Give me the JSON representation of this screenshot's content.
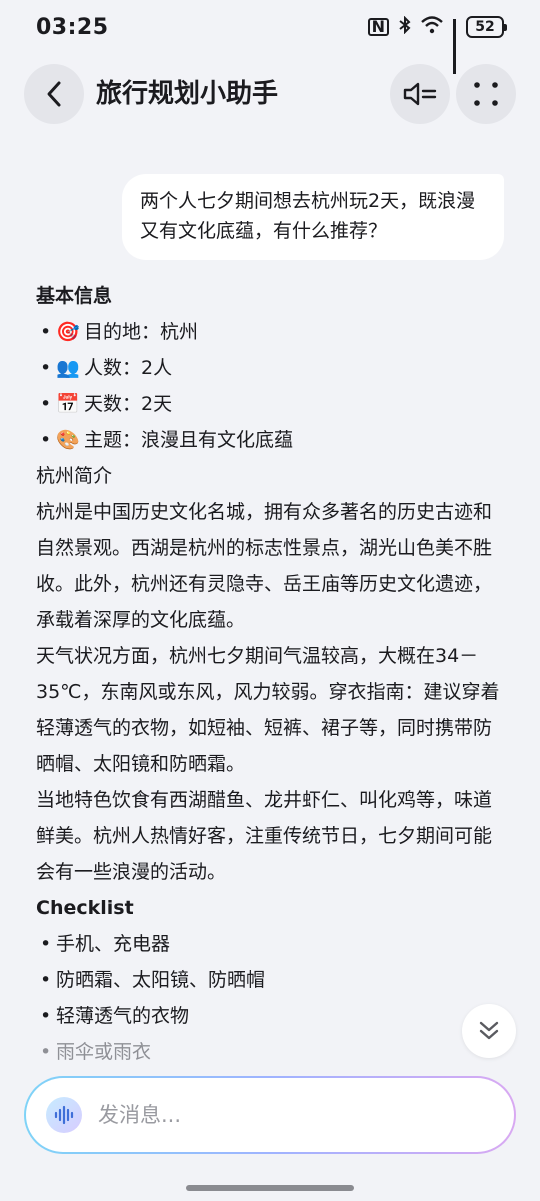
{
  "status": {
    "time": "03:25",
    "nfc": "N",
    "battery": "52"
  },
  "header": {
    "title": "旅行规划小助手"
  },
  "user_message": "两个人七夕期间想去杭州玩2天，既浪漫又有文化底蕴，有什么推荐？",
  "response": {
    "basic_title": "基本信息",
    "basic_items": [
      {
        "emoji": "🎯",
        "label": "目的地：杭州"
      },
      {
        "emoji": "👥",
        "label": "人数：2人"
      },
      {
        "emoji": "📅",
        "label": "天数：2天"
      },
      {
        "emoji": "🎨",
        "label": "主题：浪漫且有文化底蕴"
      }
    ],
    "intro_title": "杭州简介",
    "intro_text": "杭州是中国历史文化名城，拥有众多著名的历史古迹和自然景观。西湖是杭州的标志性景点，湖光山色美不胜收。此外，杭州还有灵隐寺、岳王庙等历史文化遗迹，承载着深厚的文化底蕴。",
    "weather_text": "天气状况方面，杭州七夕期间气温较高，大概在34－35℃，东南风或东风，风力较弱。穿衣指南：建议穿着轻薄透气的衣物，如短袖、短裤、裙子等，同时携带防晒帽、太阳镜和防晒霜。",
    "food_text": "当地特色饮食有西湖醋鱼、龙井虾仁、叫化鸡等，味道鲜美。杭州人热情好客，注重传统节日，七夕期间可能会有一些浪漫的活动。",
    "checklist_title": "Checklist",
    "checklist_items": [
      "手机、充电器",
      "防晒霜、太阳镜、防晒帽",
      "轻薄透气的衣物",
      "雨伞或雨衣"
    ]
  },
  "input": {
    "placeholder": "发消息..."
  }
}
